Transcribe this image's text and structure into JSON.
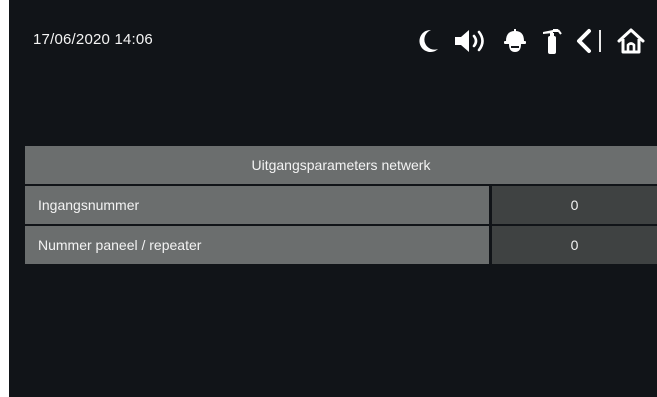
{
  "status": {
    "datetime": "17/06/2020  14:06"
  },
  "toolbar": {
    "icons": [
      "moon-icon",
      "speaker-icon",
      "firefighter-helmet-icon",
      "fire-extinguisher-icon",
      "back-chevron-icon",
      "home-icon"
    ]
  },
  "panel": {
    "title": "Uitgangsparameters netwerk",
    "rows": [
      {
        "label": "Ingangsnummer",
        "value": "0"
      },
      {
        "label": "Nummer paneel / repeater",
        "value": "0"
      }
    ]
  },
  "colors": {
    "screen_bg": "#111418",
    "row_label_bg": "#6b6e6e",
    "row_value_bg": "#3f4242",
    "text": "#f3f3f3"
  }
}
